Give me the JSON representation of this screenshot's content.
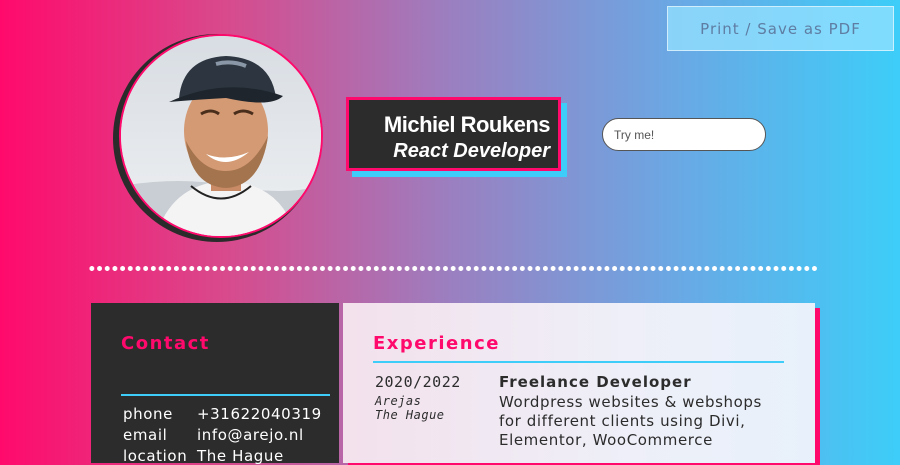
{
  "toolbar": {
    "print_label": "Print / Save as PDF"
  },
  "profile": {
    "name": "Michiel Roukens",
    "role": "React Developer",
    "try_placeholder": "Try me!"
  },
  "contact": {
    "heading": "Contact",
    "rows": [
      {
        "key": "phone",
        "value": "+31622040319"
      },
      {
        "key": "email",
        "value": "info@arejo.nl"
      },
      {
        "key": "location",
        "value": "The Hague"
      }
    ]
  },
  "experience": {
    "heading": "Experience",
    "items": [
      {
        "period": "2020/2022",
        "company": "Arejas",
        "city": "The Hague",
        "title": "Freelance Developer",
        "description": "Wordpress websites & webshops for different clients using Divi, Elementor, WooCommerce"
      }
    ]
  },
  "colors": {
    "accent_pink": "#ff0a6c",
    "accent_blue": "#3dcdf8",
    "dark": "#2c2c2c"
  }
}
